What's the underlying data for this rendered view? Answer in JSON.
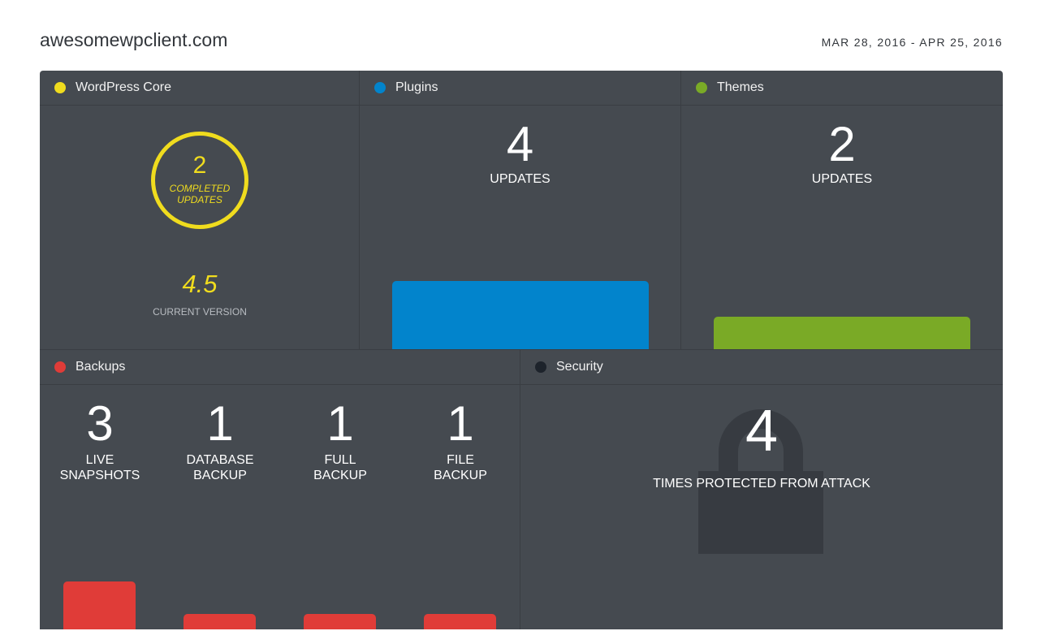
{
  "header": {
    "site": "awesomewpclient.com",
    "date_range": "MAR 28, 2016 - APR 25, 2016"
  },
  "colors": {
    "wordpress_core": "#f0dc1e",
    "plugins": "#0284cc",
    "themes": "#7aaa26",
    "backups": "#e03c38",
    "security": "#1d232b",
    "dashboard_bg": "#454a50"
  },
  "core": {
    "title": "WordPress Core",
    "completed_count": "2",
    "completed_label": "COMPLETED UPDATES",
    "version": "4.5",
    "version_label": "CURRENT VERSION"
  },
  "plugins": {
    "title": "Plugins",
    "count": "4",
    "label": "UPDATES",
    "bar_level": 0.28
  },
  "themes": {
    "title": "Themes",
    "count": "2",
    "label": "UPDATES",
    "bar_level": 0.135
  },
  "backups": {
    "title": "Backups",
    "items": [
      {
        "count": "3",
        "label": "LIVE\nSNAPSHOTS",
        "bar_level": 0.5
      },
      {
        "count": "1",
        "label": "DATABASE\nBACKUP",
        "bar_level": 0.167
      },
      {
        "count": "1",
        "label": "FULL\nBACKUP",
        "bar_level": 0.167
      },
      {
        "count": "1",
        "label": "FILE\nBACKUP",
        "bar_level": 0.167
      }
    ]
  },
  "security": {
    "title": "Security",
    "count": "4",
    "label": "TIMES PROTECTED FROM ATTACK"
  }
}
